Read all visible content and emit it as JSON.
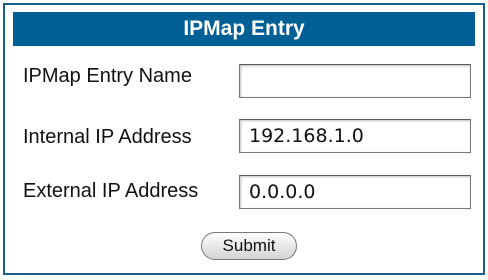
{
  "form": {
    "title": "IPMap Entry",
    "fields": [
      {
        "label": "IPMap Entry Name",
        "value": ""
      },
      {
        "label": "Internal IP Address",
        "value": "192.168.1.0"
      },
      {
        "label": "External IP Address",
        "value": "0.0.0.0"
      }
    ],
    "submit_label": "Submit"
  },
  "colors": {
    "header_bg": "#005f95",
    "border": "#1b5d8e"
  }
}
